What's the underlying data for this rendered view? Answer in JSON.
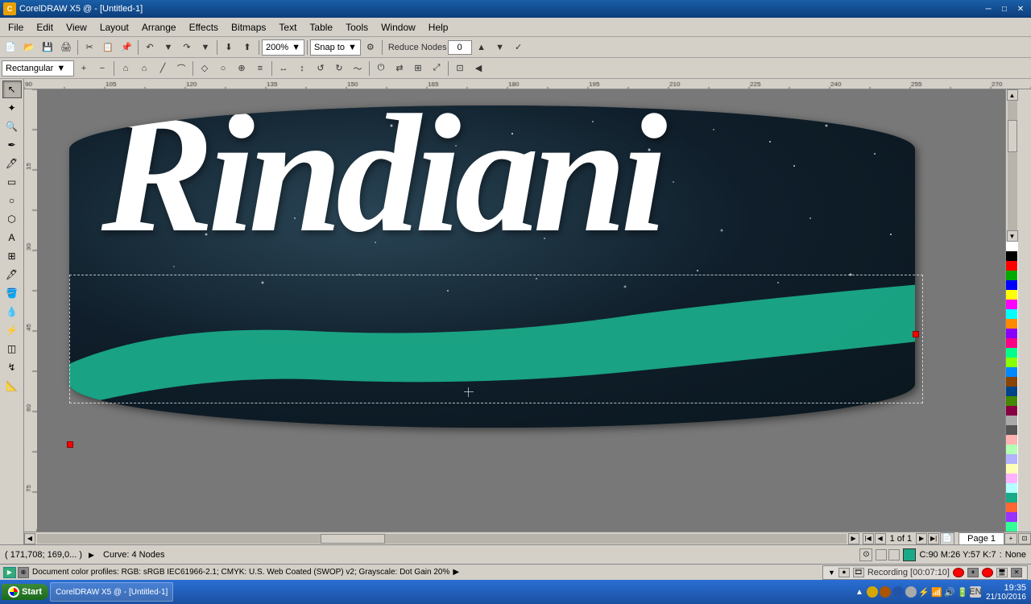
{
  "titlebar": {
    "title": "CorelDRAW X5 @ - [Untitled-1]",
    "icon_label": "C",
    "controls": [
      "_",
      "□",
      "✕"
    ]
  },
  "menubar": {
    "items": [
      "File",
      "Edit",
      "View",
      "Layout",
      "Arrange",
      "Effects",
      "Bitmaps",
      "Text",
      "Table",
      "Tools",
      "Window",
      "Help"
    ]
  },
  "toolbar1": {
    "zoom_value": "200%",
    "snap_label": "Snap to",
    "reduce_nodes_label": "Reduce Nodes",
    "reduce_nodes_value": "0"
  },
  "toolbar2": {
    "shape_selector": "Rectangular"
  },
  "canvas": {
    "title": "Rindiani",
    "background_color": "#0d1e28"
  },
  "statusbar": {
    "page_info": "1 of 1",
    "page_name": "Page 1",
    "cursor": "( 171,708; 169,0... )",
    "curve_info": "Curve: 4 Nodes"
  },
  "infobar": {
    "doc_profile": "Document color profiles: RGB: sRGB IEC61966-2.1; CMYK: U.S. Web Coated (SWOP) v2; Grayscale: Dot Gain 20%",
    "color_mode": "C:90 M:26 Y:57 K:7",
    "fill": "None"
  },
  "recording": {
    "label": "Recording [00:07:10]"
  },
  "taskbar": {
    "start_label": "Start",
    "time": "19:35",
    "date": "21/10/2016"
  },
  "palette_colors": [
    "#FFFFFF",
    "#000000",
    "#FF0000",
    "#00AA00",
    "#0000FF",
    "#FFFF00",
    "#FF00FF",
    "#00FFFF",
    "#FF8800",
    "#8800FF",
    "#FF0088",
    "#00FF88",
    "#88FF00",
    "#0088FF",
    "#884400",
    "#004488",
    "#448800",
    "#880044",
    "#AAAAAA",
    "#555555",
    "#FFB3B3",
    "#B3FFB3",
    "#B3B3FF",
    "#FFFFB3",
    "#FFB3FF",
    "#B3FFFF",
    "#1AAA88",
    "#FF6633",
    "#9933FF",
    "#33FF99"
  ]
}
